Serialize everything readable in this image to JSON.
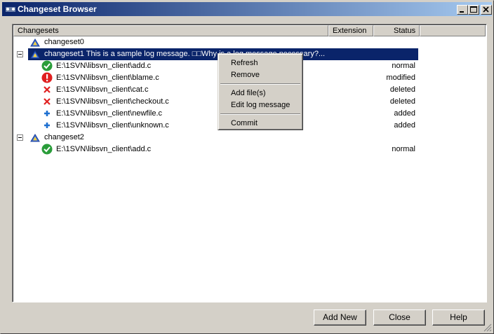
{
  "window": {
    "title": "Changeset Browser"
  },
  "columns": {
    "name": "Changesets",
    "extension": "Extension",
    "status": "Status"
  },
  "changesets": [
    {
      "label": "changeset0"
    },
    {
      "label": "changeset1 This is a sample log message. □□Why is a log message necessary?...",
      "files": [
        {
          "path": "E:\\1SVN\\libsvn_client\\add.c",
          "status": "normal",
          "icon": "check-icon"
        },
        {
          "path": "E:\\1SVN\\libsvn_client\\blame.c",
          "status": "modified",
          "icon": "exclamation-icon"
        },
        {
          "path": "E:\\1SVN\\libsvn_client\\cat.c",
          "status": "deleted",
          "icon": "cross-icon"
        },
        {
          "path": "E:\\1SVN\\libsvn_client\\checkout.c",
          "status": "deleted",
          "icon": "cross-icon"
        },
        {
          "path": "E:\\1SVN\\libsvn_client\\newfile.c",
          "status": "added",
          "icon": "plus-icon"
        },
        {
          "path": "E:\\1SVN\\libsvn_client\\unknown.c",
          "status": "added",
          "icon": "plus-icon"
        }
      ]
    },
    {
      "label": "changeset2",
      "files": [
        {
          "path": "E:\\1SVN\\libsvn_client\\add.c",
          "status": "normal",
          "icon": "check-icon"
        }
      ]
    }
  ],
  "context_menu": {
    "refresh": "Refresh",
    "remove": "Remove",
    "add_files": "Add file(s)",
    "edit_log": "Edit log message",
    "commit": "Commit"
  },
  "buttons": {
    "add_new": "Add New",
    "close": "Close",
    "help": "Help"
  },
  "colors": {
    "selection": "#0a246a",
    "title_gradient_start": "#0a246a",
    "title_gradient_end": "#a6caf0"
  }
}
